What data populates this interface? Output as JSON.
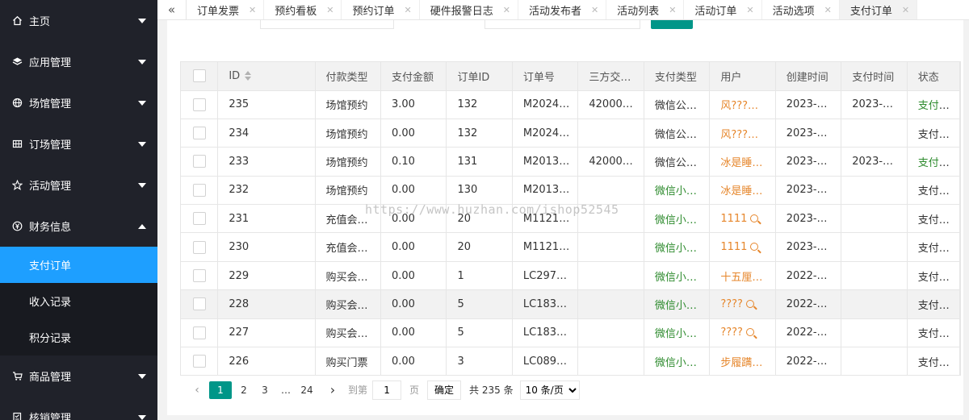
{
  "sidebar": {
    "items": [
      {
        "label": "主页",
        "icon": "home-icon"
      },
      {
        "label": "应用管理",
        "icon": "layers-icon"
      },
      {
        "label": "场馆管理",
        "icon": "globe-icon"
      },
      {
        "label": "订场管理",
        "icon": "grid-icon"
      },
      {
        "label": "活动管理",
        "icon": "star-icon"
      },
      {
        "label": "财务信息",
        "icon": "yen-icon",
        "expanded": true
      },
      {
        "label": "商品管理",
        "icon": "cart-icon"
      },
      {
        "label": "核销管理",
        "icon": "checklist-icon"
      }
    ],
    "finance_children": [
      "支付订单",
      "收入记录",
      "积分记录"
    ],
    "active_child": "支付订单"
  },
  "tabs": [
    {
      "label": "订单发票"
    },
    {
      "label": "预约看板"
    },
    {
      "label": "预约订单"
    },
    {
      "label": "硬件报警日志"
    },
    {
      "label": "活动发布者"
    },
    {
      "label": "活动列表"
    },
    {
      "label": "活动订单"
    },
    {
      "label": "活动选项"
    },
    {
      "label": "支付订单",
      "active": true
    }
  ],
  "table": {
    "headers": [
      "ID",
      "付款类型",
      "支付金额",
      "订单ID",
      "订单号",
      "三方交…",
      "支付类型",
      "用户",
      "创建时间",
      "支付时间",
      "状态"
    ],
    "rows": [
      {
        "id": "235",
        "pay_kind": "场馆预约",
        "amount": "3.00",
        "order_id": "132",
        "order_no": "M2024…",
        "third": "42000…",
        "pay_type": "微信公…",
        "pay_type_green": false,
        "user": "风???…",
        "user_search": false,
        "created": "2023-…",
        "paid": "2023-…",
        "status": "支付成功",
        "ok": true
      },
      {
        "id": "234",
        "pay_kind": "场馆预约",
        "amount": "0.00",
        "order_id": "132",
        "order_no": "M2024…",
        "third": "",
        "pay_type": "微信公…",
        "pay_type_green": false,
        "user": "风???…",
        "user_search": false,
        "created": "2023-…",
        "paid": "",
        "status": "支付失败",
        "ok": false
      },
      {
        "id": "233",
        "pay_kind": "场馆预约",
        "amount": "0.10",
        "order_id": "131",
        "order_no": "M2013…",
        "third": "42000…",
        "pay_type": "微信公…",
        "pay_type_green": false,
        "user": "冰是睡…",
        "user_search": false,
        "created": "2023-…",
        "paid": "2023-…",
        "status": "支付成功",
        "ok": true
      },
      {
        "id": "232",
        "pay_kind": "场馆预约",
        "amount": "0.00",
        "order_id": "130",
        "order_no": "M2013…",
        "third": "",
        "pay_type": "微信小…",
        "pay_type_green": true,
        "user": "冰是睡…",
        "user_search": false,
        "created": "2023-…",
        "paid": "",
        "status": "支付失败",
        "ok": false
      },
      {
        "id": "231",
        "pay_kind": "充值会…",
        "amount": "0.00",
        "order_id": "20",
        "order_no": "M1121…",
        "third": "",
        "pay_type": "微信小…",
        "pay_type_green": true,
        "user": "1111",
        "user_search": true,
        "created": "2023-…",
        "paid": "",
        "status": "支付失败",
        "ok": false
      },
      {
        "id": "230",
        "pay_kind": "充值会…",
        "amount": "0.00",
        "order_id": "20",
        "order_no": "M1121…",
        "third": "",
        "pay_type": "微信小…",
        "pay_type_green": true,
        "user": "1111",
        "user_search": true,
        "created": "2023-…",
        "paid": "",
        "status": "支付失败",
        "ok": false
      },
      {
        "id": "229",
        "pay_kind": "购买会…",
        "amount": "0.00",
        "order_id": "1",
        "order_no": "LC297…",
        "third": "",
        "pay_type": "微信小…",
        "pay_type_green": true,
        "user": "十五厘…",
        "user_search": false,
        "created": "2022-…",
        "paid": "",
        "status": "支付失败",
        "ok": false
      },
      {
        "id": "228",
        "pay_kind": "购买会…",
        "amount": "0.00",
        "order_id": "5",
        "order_no": "LC183…",
        "third": "",
        "pay_type": "微信小…",
        "pay_type_green": true,
        "user": "????",
        "user_search": true,
        "created": "2022-…",
        "paid": "",
        "status": "支付失败",
        "ok": false,
        "hover": true
      },
      {
        "id": "227",
        "pay_kind": "购买会…",
        "amount": "0.00",
        "order_id": "5",
        "order_no": "LC183…",
        "third": "",
        "pay_type": "微信小…",
        "pay_type_green": true,
        "user": "????",
        "user_search": true,
        "created": "2022-…",
        "paid": "",
        "status": "支付失败",
        "ok": false
      },
      {
        "id": "226",
        "pay_kind": "购买门票",
        "amount": "0.00",
        "order_id": "3",
        "order_no": "LC089…",
        "third": "",
        "pay_type": "微信小…",
        "pay_type_green": true,
        "user": "步履蹒…",
        "user_search": false,
        "created": "2022-…",
        "paid": "",
        "status": "支付失败",
        "ok": false
      }
    ]
  },
  "pager": {
    "prev_icon": "chevron-left-icon",
    "next_icon": "chevron-right-icon",
    "pages": [
      "1",
      "2",
      "3",
      "…",
      "24"
    ],
    "current": "1",
    "goto_label": "到第",
    "goto_value": "1",
    "page_unit": "页",
    "confirm_label": "确定",
    "total_label": "共 235 条",
    "page_size_selected": "10 条/页"
  },
  "watermark": "https://www.huzhan.com/ishop52545",
  "colors": {
    "sidebar_bg": "#20222a",
    "active_blue": "#1e9fff",
    "teal": "#009688",
    "success_green": "#2e8b2e",
    "user_orange": "#e6862b"
  }
}
